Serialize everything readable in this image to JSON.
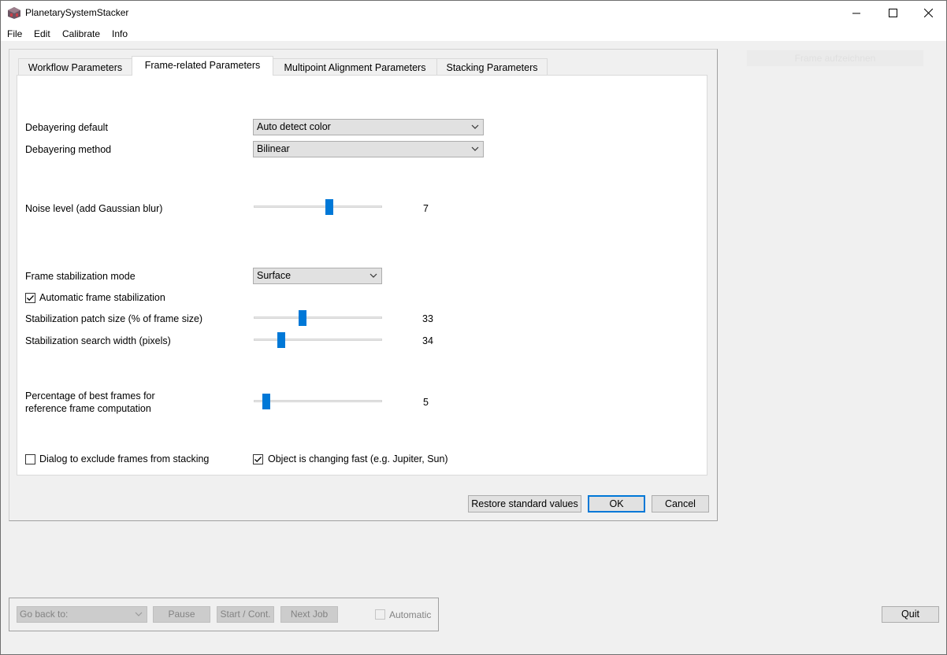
{
  "window": {
    "title": "PlanetarySystemStacker",
    "controls": {
      "minimize": "–",
      "maximize": "☐",
      "close": "✕"
    }
  },
  "menu": [
    "File",
    "Edit",
    "Calibrate",
    "Info"
  ],
  "ghost_button": "Frame aufzeichnen",
  "tabs": [
    {
      "label": "Workflow Parameters",
      "active": false
    },
    {
      "label": "Frame-related Parameters",
      "active": true
    },
    {
      "label": "Multipoint Alignment Parameters",
      "active": false
    },
    {
      "label": "Stacking Parameters",
      "active": false
    }
  ],
  "params": {
    "debayering_default": {
      "label": "Debayering default",
      "value": "Auto detect color"
    },
    "debayering_method": {
      "label": "Debayering method",
      "value": "Bilinear"
    },
    "noise_level": {
      "label": "Noise level (add Gaussian blur)",
      "value": "7",
      "fraction": 0.59
    },
    "stabilization_mode": {
      "label": "Frame stabilization  mode",
      "value": "Surface"
    },
    "auto_stabilization": {
      "label": "Automatic frame stabilization",
      "checked": true
    },
    "patch_size": {
      "label": "Stabilization patch size (% of frame size)",
      "value": "33",
      "fraction": 0.38
    },
    "search_width": {
      "label": "Stabilization search width (pixels)",
      "value": "34",
      "fraction": 0.215
    },
    "best_frames": {
      "label_line1": "Percentage of best frames for",
      "label_line2": "reference frame computation",
      "value": "5",
      "fraction": 0.1
    },
    "exclude_dialog": {
      "label": "Dialog to exclude frames from stacking",
      "checked": false
    },
    "changing_fast": {
      "label": "Object is changing fast (e.g. Jupiter, Sun)",
      "checked": true
    }
  },
  "dialog_buttons": {
    "restore": "Restore standard values",
    "ok": "OK",
    "cancel": "Cancel"
  },
  "jobbar": {
    "go_back_placeholder": "Go back to:",
    "pause": "Pause",
    "start_cont": "Start / Cont.",
    "next_job": "Next Job",
    "automatic": "Automatic"
  },
  "quit": "Quit",
  "colors": {
    "accent": "#0078d7",
    "panel": "#ffffff",
    "background": "#f0f0f0"
  }
}
